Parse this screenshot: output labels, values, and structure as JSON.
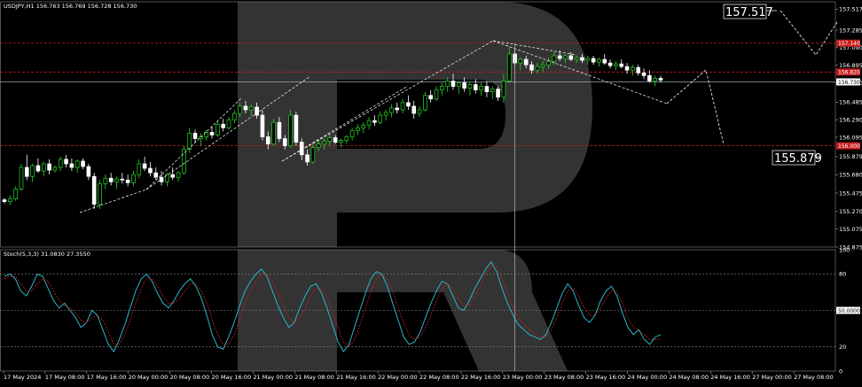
{
  "header": {
    "main": "USDJPY,H1  156.763 156.769 156.728 156.730",
    "osc": "Stoch(5,3,3) 31.0830 27.3550"
  },
  "colors": {
    "background": "#000000",
    "bull": "#26d826",
    "bear": "#ffffff",
    "level_line": "#c81e1e",
    "stoch_main": "#2bb5c8",
    "stoch_signal": "#d02020",
    "forecast": "#ffffff",
    "price_tag_red": "#c81e1e",
    "price_tag_current": "#ffffff"
  },
  "chart_data": [
    {
      "type": "candlestick",
      "symbol": "USDJPY",
      "timeframe": "H1",
      "ylim": [
        154.875,
        157.6
      ],
      "y_ticks": [
        "157.517",
        "157.285",
        "157.090",
        "156.895",
        "156.700",
        "156.485",
        "156.290",
        "156.095",
        "155.879",
        "155.680",
        "155.475",
        "155.270",
        "155.075",
        "154.875"
      ],
      "x_ticks": [
        "17 May 2024",
        "17 May 08:00",
        "17 May 16:00",
        "20 May 00:00",
        "20 May 08:00",
        "20 May 16:00",
        "21 May 00:00",
        "21 May 08:00",
        "21 May 16:00",
        "22 May 00:00",
        "22 May 08:00",
        "22 May 16:00",
        "23 May 00:00",
        "23 May 08:00",
        "23 May 16:00",
        "24 May 00:00",
        "24 May 08:00",
        "24 May 16:00",
        "27 May 00:00",
        "27 May 08:00"
      ],
      "levels": [
        157.14,
        156.82,
        156.71,
        156.0
      ],
      "level_tags": [
        "157.140",
        "156.820",
        "156.730",
        "156.000"
      ],
      "current_price": 156.73,
      "marker_labels": {
        "upper": "157.517",
        "lower": "155.879"
      },
      "candles": [
        [
          155.4,
          155.42,
          155.36,
          155.38
        ],
        [
          155.38,
          155.45,
          155.34,
          155.41
        ],
        [
          155.41,
          155.55,
          155.39,
          155.52
        ],
        [
          155.52,
          155.8,
          155.5,
          155.76
        ],
        [
          155.76,
          155.9,
          155.62,
          155.66
        ],
        [
          155.66,
          155.8,
          155.6,
          155.78
        ],
        [
          155.78,
          155.86,
          155.7,
          155.72
        ],
        [
          155.72,
          155.82,
          155.66,
          155.8
        ],
        [
          155.8,
          155.85,
          155.68,
          155.73
        ],
        [
          155.73,
          155.78,
          155.7,
          155.76
        ],
        [
          155.76,
          155.88,
          155.72,
          155.85
        ],
        [
          155.85,
          155.9,
          155.76,
          155.8
        ],
        [
          155.8,
          155.86,
          155.72,
          155.76
        ],
        [
          155.76,
          155.85,
          155.7,
          155.83
        ],
        [
          155.83,
          155.86,
          155.74,
          155.77
        ],
        [
          155.77,
          155.8,
          155.62,
          155.66
        ],
        [
          155.66,
          155.7,
          155.3,
          155.35
        ],
        [
          155.35,
          155.62,
          155.3,
          155.58
        ],
        [
          155.58,
          155.68,
          155.52,
          155.64
        ],
        [
          155.64,
          155.7,
          155.56,
          155.6
        ],
        [
          155.6,
          155.66,
          155.52,
          155.63
        ],
        [
          155.63,
          155.7,
          155.58,
          155.62
        ],
        [
          155.62,
          155.68,
          155.55,
          155.59
        ],
        [
          155.59,
          155.72,
          155.55,
          155.68
        ],
        [
          155.68,
          155.85,
          155.64,
          155.8
        ],
        [
          155.8,
          155.88,
          155.72,
          155.75
        ],
        [
          155.75,
          155.82,
          155.66,
          155.7
        ],
        [
          155.7,
          155.76,
          155.62,
          155.65
        ],
        [
          155.65,
          155.72,
          155.56,
          155.6
        ],
        [
          155.6,
          155.7,
          155.55,
          155.68
        ],
        [
          155.68,
          155.76,
          155.62,
          155.65
        ],
        [
          155.65,
          155.72,
          155.6,
          155.7
        ],
        [
          155.7,
          156.0,
          155.68,
          155.96
        ],
        [
          155.96,
          156.2,
          155.92,
          156.14
        ],
        [
          156.14,
          156.18,
          156.04,
          156.08
        ],
        [
          156.08,
          156.14,
          156.0,
          156.1
        ],
        [
          156.1,
          156.18,
          156.06,
          156.15
        ],
        [
          156.15,
          156.22,
          156.08,
          156.12
        ],
        [
          156.12,
          156.28,
          156.1,
          156.24
        ],
        [
          156.24,
          156.3,
          156.16,
          156.2
        ],
        [
          156.2,
          156.32,
          156.18,
          156.29
        ],
        [
          156.29,
          156.4,
          156.25,
          156.36
        ],
        [
          156.36,
          156.48,
          156.32,
          156.44
        ],
        [
          156.44,
          156.5,
          156.36,
          156.4
        ],
        [
          156.4,
          156.46,
          156.34,
          156.43
        ],
        [
          156.43,
          156.48,
          156.3,
          156.34
        ],
        [
          156.34,
          156.4,
          156.06,
          156.1
        ],
        [
          156.1,
          156.16,
          155.96,
          156.02
        ],
        [
          156.02,
          156.3,
          156.0,
          156.26
        ],
        [
          156.26,
          156.32,
          156.04,
          156.08
        ],
        [
          156.08,
          156.12,
          155.96,
          156.0
        ],
        [
          156.0,
          156.4,
          155.98,
          156.34
        ],
        [
          156.34,
          156.38,
          156.0,
          156.04
        ],
        [
          156.04,
          156.08,
          155.84,
          155.9
        ],
        [
          155.9,
          155.96,
          155.78,
          155.82
        ],
        [
          155.82,
          156.02,
          155.8,
          155.98
        ],
        [
          155.98,
          156.06,
          155.94,
          156.02
        ],
        [
          156.02,
          156.08,
          155.96,
          156.05
        ],
        [
          156.05,
          156.12,
          156.0,
          156.09
        ],
        [
          156.09,
          156.12,
          156.02,
          156.04
        ],
        [
          156.04,
          156.08,
          155.98,
          156.06
        ],
        [
          156.06,
          156.12,
          156.02,
          156.1
        ],
        [
          156.1,
          156.2,
          156.06,
          156.17
        ],
        [
          156.17,
          156.24,
          156.12,
          156.2
        ],
        [
          156.2,
          156.26,
          156.14,
          156.23
        ],
        [
          156.23,
          156.32,
          156.18,
          156.28
        ],
        [
          156.28,
          156.34,
          156.22,
          156.26
        ],
        [
          156.26,
          156.38,
          156.24,
          156.34
        ],
        [
          156.34,
          156.4,
          156.28,
          156.37
        ],
        [
          156.37,
          156.46,
          156.32,
          156.42
        ],
        [
          156.42,
          156.48,
          156.36,
          156.4
        ],
        [
          156.4,
          156.52,
          156.36,
          156.48
        ],
        [
          156.48,
          156.56,
          156.4,
          156.44
        ],
        [
          156.44,
          156.5,
          156.3,
          156.36
        ],
        [
          156.36,
          156.44,
          156.32,
          156.4
        ],
        [
          156.4,
          156.6,
          156.38,
          156.56
        ],
        [
          156.56,
          156.62,
          156.48,
          156.52
        ],
        [
          156.52,
          156.66,
          156.5,
          156.62
        ],
        [
          156.62,
          156.7,
          156.56,
          156.66
        ],
        [
          156.66,
          156.76,
          156.6,
          156.72
        ],
        [
          156.72,
          156.8,
          156.62,
          156.66
        ],
        [
          156.66,
          156.72,
          156.58,
          156.7
        ],
        [
          156.7,
          156.76,
          156.6,
          156.64
        ],
        [
          156.64,
          156.7,
          156.56,
          156.68
        ],
        [
          156.68,
          156.74,
          156.58,
          156.62
        ],
        [
          156.62,
          156.7,
          156.56,
          156.66
        ],
        [
          156.66,
          156.72,
          156.54,
          156.6
        ],
        [
          156.6,
          156.66,
          156.52,
          156.63
        ],
        [
          156.63,
          156.66,
          156.5,
          156.54
        ],
        [
          156.54,
          156.8,
          156.48,
          156.72
        ],
        [
          156.72,
          157.1,
          156.7,
          157.02
        ],
        [
          157.02,
          157.06,
          156.88,
          156.92
        ],
        [
          156.92,
          156.98,
          156.84,
          156.96
        ],
        [
          156.96,
          157.0,
          156.86,
          156.9
        ],
        [
          156.9,
          156.94,
          156.8,
          156.84
        ],
        [
          156.84,
          156.92,
          156.8,
          156.88
        ],
        [
          156.88,
          156.94,
          156.82,
          156.9
        ],
        [
          156.9,
          156.98,
          156.86,
          156.94
        ],
        [
          156.94,
          157.04,
          156.9,
          157.0
        ],
        [
          157.0,
          157.06,
          156.94,
          156.97
        ],
        [
          156.97,
          157.02,
          156.92,
          157.0
        ],
        [
          157.0,
          157.04,
          156.94,
          156.96
        ],
        [
          156.96,
          157.0,
          156.92,
          156.98
        ],
        [
          156.98,
          157.02,
          156.92,
          156.95
        ],
        [
          156.95,
          157.0,
          156.9,
          156.97
        ],
        [
          156.97,
          157.0,
          156.9,
          156.93
        ],
        [
          156.93,
          156.98,
          156.88,
          156.96
        ],
        [
          156.96,
          157.02,
          156.9,
          156.92
        ],
        [
          156.92,
          156.96,
          156.86,
          156.89
        ],
        [
          156.89,
          156.94,
          156.84,
          156.91
        ],
        [
          156.91,
          156.96,
          156.86,
          156.88
        ],
        [
          156.88,
          156.92,
          156.8,
          156.84
        ],
        [
          156.84,
          156.9,
          156.78,
          156.87
        ],
        [
          156.87,
          156.9,
          156.78,
          156.81
        ],
        [
          156.81,
          156.86,
          156.74,
          156.78
        ],
        [
          156.78,
          156.84,
          156.7,
          156.72
        ],
        [
          156.72,
          156.78,
          156.66,
          156.75
        ],
        [
          156.75,
          156.78,
          156.7,
          156.73
        ]
      ]
    },
    {
      "type": "line",
      "name": "Stoch(5,3,3)",
      "ylim": [
        0,
        100
      ],
      "y_ticks": [
        "100",
        "80",
        "50.0000",
        "20",
        "0"
      ],
      "series": [
        {
          "values": [
            78,
            80,
            76,
            66,
            62,
            70,
            80,
            78,
            68,
            58,
            52,
            56,
            50,
            44,
            36,
            40,
            50,
            46,
            34,
            22,
            16,
            26,
            38,
            52,
            66,
            76,
            80,
            74,
            64,
            56,
            52,
            58,
            66,
            72,
            76,
            70,
            60,
            46,
            30,
            20,
            18,
            28,
            40,
            54,
            66,
            74,
            80,
            84,
            78,
            66,
            54,
            44,
            36,
            40,
            52,
            62,
            70,
            72,
            64,
            52,
            38,
            24,
            16,
            22,
            36,
            50,
            64,
            76,
            82,
            80,
            70,
            56,
            42,
            28,
            22,
            24,
            32,
            44,
            56,
            66,
            74,
            72,
            62,
            52,
            50,
            58,
            68,
            76,
            84,
            90,
            82,
            68,
            56,
            46,
            38,
            34,
            30,
            28,
            26,
            30,
            40,
            52,
            64,
            72,
            66,
            54,
            44,
            40,
            46,
            58,
            66,
            70,
            62,
            48,
            36,
            30,
            34,
            26,
            22,
            28,
            30
          ]
        },
        {
          "values": [
            76,
            78,
            78,
            72,
            66,
            66,
            72,
            76,
            74,
            66,
            58,
            54,
            52,
            48,
            42,
            40,
            44,
            46,
            42,
            32,
            22,
            22,
            30,
            42,
            56,
            68,
            76,
            76,
            70,
            62,
            56,
            56,
            60,
            66,
            72,
            72,
            66,
            56,
            42,
            30,
            22,
            22,
            30,
            42,
            56,
            66,
            74,
            80,
            80,
            74,
            64,
            54,
            44,
            40,
            44,
            52,
            62,
            68,
            68,
            60,
            48,
            36,
            24,
            20,
            26,
            38,
            52,
            66,
            76,
            80,
            76,
            66,
            52,
            40,
            30,
            26,
            28,
            36,
            46,
            58,
            68,
            72,
            68,
            60,
            54,
            54,
            62,
            70,
            80,
            86,
            86,
            76,
            64,
            52,
            44,
            38,
            34,
            30,
            28,
            28,
            34,
            44,
            56,
            66,
            68,
            62,
            52,
            46,
            46,
            52,
            60,
            66,
            66,
            56,
            44,
            36,
            34,
            30,
            26,
            26,
            27
          ]
        }
      ]
    }
  ]
}
